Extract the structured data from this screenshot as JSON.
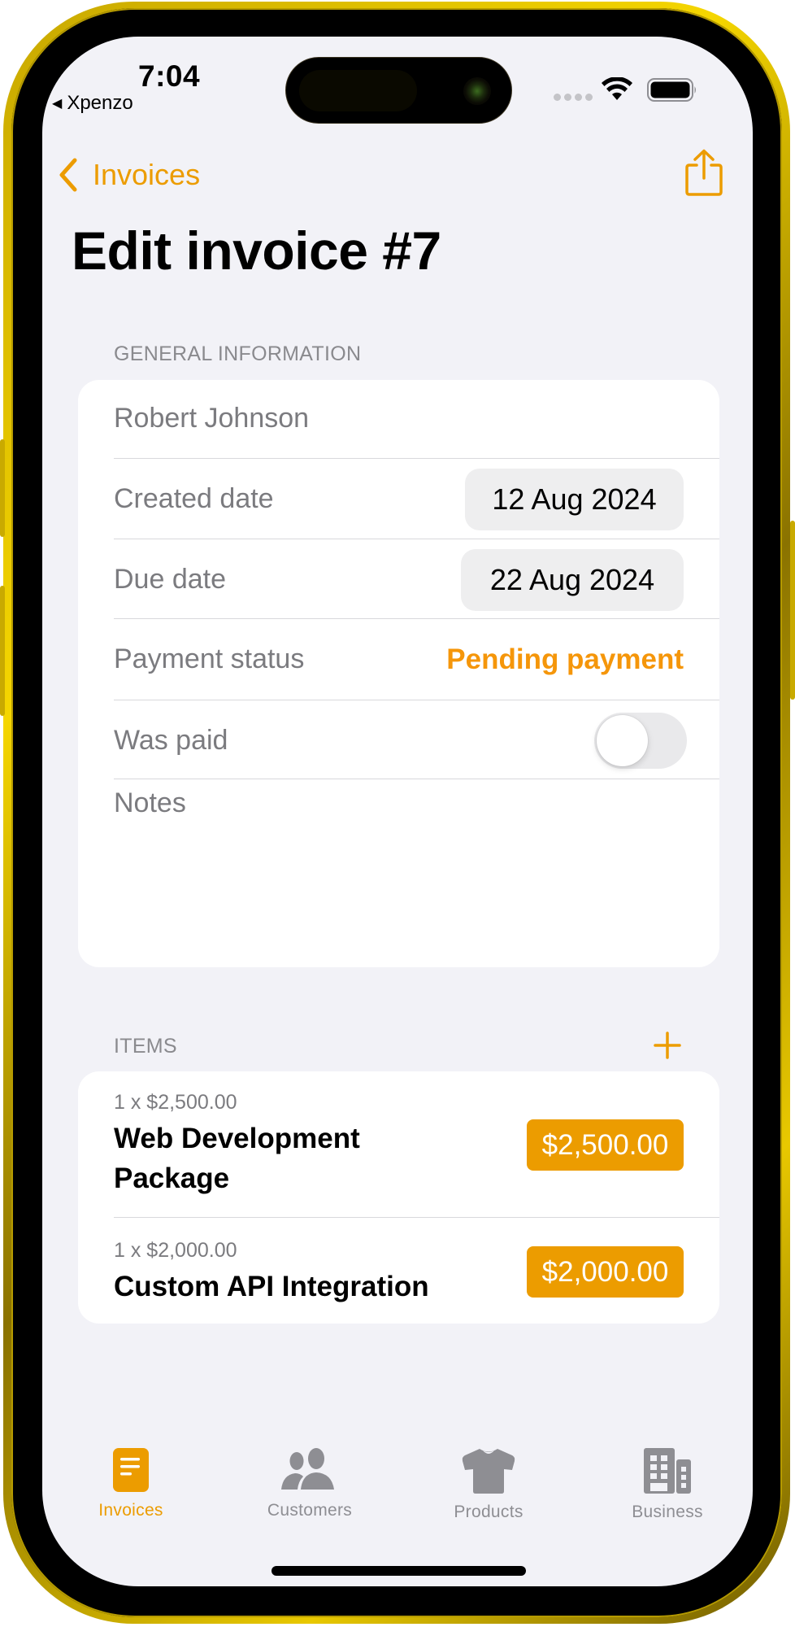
{
  "status_bar": {
    "time": "7:04",
    "return_app": "Xpenzo",
    "wifi_icon": "wifi-icon",
    "battery_icon": "battery-icon",
    "signal_icon": "cellular-signal-icon"
  },
  "nav": {
    "back_label": "Invoices",
    "back_icon": "chevron-left-icon",
    "share_icon": "share-icon"
  },
  "page": {
    "title": "Edit invoice #7"
  },
  "general_information": {
    "header": "GENERAL INFORMATION",
    "customer_name": "Robert Johnson",
    "created_date": {
      "label": "Created date",
      "value": "12 Aug 2024"
    },
    "due_date": {
      "label": "Due date",
      "value": "22 Aug 2024"
    },
    "payment_status": {
      "label": "Payment status",
      "value": "Pending payment"
    },
    "was_paid": {
      "label": "Was paid",
      "value": false
    },
    "notes": {
      "placeholder": "Notes",
      "value": ""
    }
  },
  "items": {
    "header": "ITEMS",
    "add_icon": "plus-icon",
    "list": [
      {
        "quantity_price": "1 x $2,500.00",
        "name": "Web Development Package",
        "total": "$2,500.00"
      },
      {
        "quantity_price": "1 x $2,000.00",
        "name": "Custom API Integration",
        "total": "$2,000.00"
      }
    ]
  },
  "tab_bar": {
    "tabs": [
      {
        "label": "Invoices",
        "icon": "invoice-doc-icon",
        "active": true
      },
      {
        "label": "Customers",
        "icon": "people-icon",
        "active": false
      },
      {
        "label": "Products",
        "icon": "tshirt-icon",
        "active": false
      },
      {
        "label": "Business",
        "icon": "building-icon",
        "active": false
      }
    ]
  },
  "colors": {
    "accent": "#ec9c00",
    "status_pending": "#f5960a",
    "background": "#f2f2f7",
    "secondary_text": "#7b7b7f",
    "inactive_tab": "#8e8e93"
  }
}
